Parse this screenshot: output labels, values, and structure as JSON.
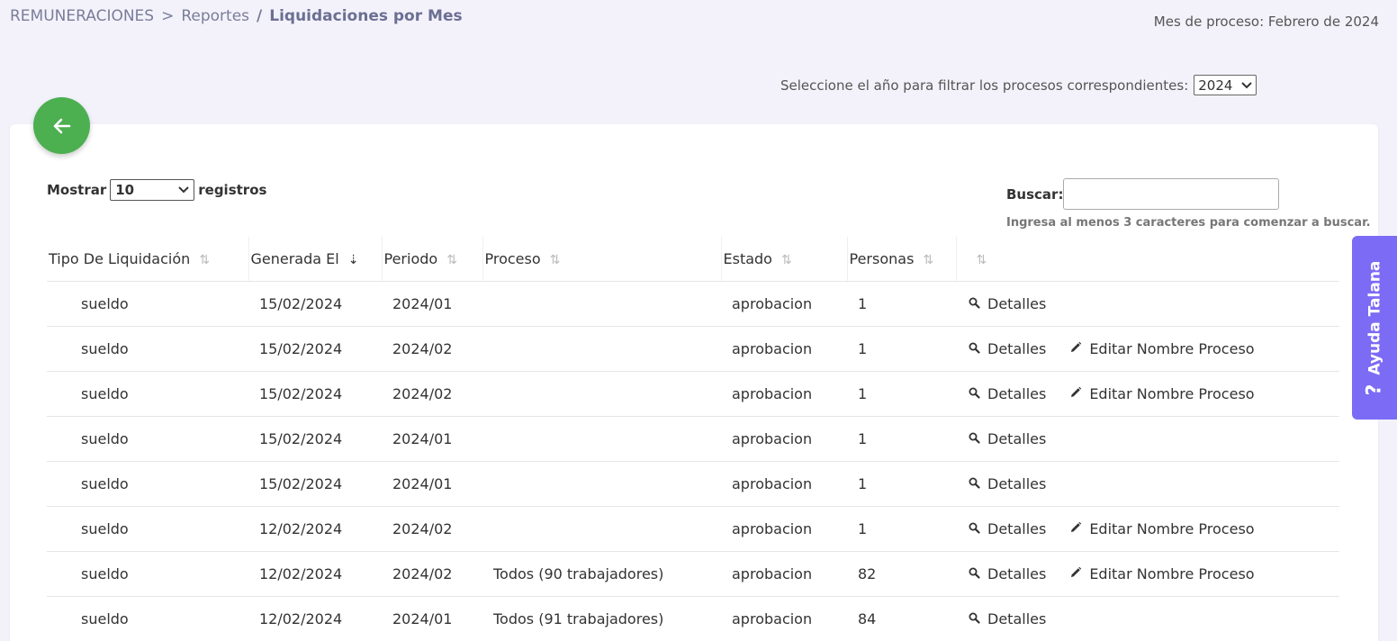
{
  "breadcrumb": {
    "root": "REMUNERACIONES",
    "sep1": ">",
    "level2": "Reportes",
    "sep2": "/",
    "current": "Liquidaciones por Mes"
  },
  "process_month": "Mes de proceso: Febrero de 2024",
  "year_filter": {
    "label": "Seleccione el año para filtrar los procesos correspondientes:",
    "value": "2024"
  },
  "length": {
    "prefix": "Mostrar",
    "value": "10",
    "suffix": "registros"
  },
  "search": {
    "label": "Buscar:",
    "value": "",
    "hint": "Ingresa al menos 3 caracteres para comenzar a buscar."
  },
  "table": {
    "headers": [
      "Tipo De Liquidación",
      "Generada El",
      "Periodo",
      "Proceso",
      "Estado",
      "Personas",
      ""
    ],
    "rows": [
      {
        "tipo": "sueldo",
        "generada": "15/02/2024",
        "periodo": "2024/01",
        "proceso": "",
        "estado": "aprobacion",
        "personas": "1",
        "detalles": "Detalles",
        "editar": ""
      },
      {
        "tipo": "sueldo",
        "generada": "15/02/2024",
        "periodo": "2024/02",
        "proceso": "",
        "estado": "aprobacion",
        "personas": "1",
        "detalles": "Detalles",
        "editar": "Editar Nombre Proceso"
      },
      {
        "tipo": "sueldo",
        "generada": "15/02/2024",
        "periodo": "2024/02",
        "proceso": "",
        "estado": "aprobacion",
        "personas": "1",
        "detalles": "Detalles",
        "editar": "Editar Nombre Proceso"
      },
      {
        "tipo": "sueldo",
        "generada": "15/02/2024",
        "periodo": "2024/01",
        "proceso": "",
        "estado": "aprobacion",
        "personas": "1",
        "detalles": "Detalles",
        "editar": ""
      },
      {
        "tipo": "sueldo",
        "generada": "15/02/2024",
        "periodo": "2024/01",
        "proceso": "",
        "estado": "aprobacion",
        "personas": "1",
        "detalles": "Detalles",
        "editar": ""
      },
      {
        "tipo": "sueldo",
        "generada": "12/02/2024",
        "periodo": "2024/02",
        "proceso": "",
        "estado": "aprobacion",
        "personas": "1",
        "detalles": "Detalles",
        "editar": "Editar Nombre Proceso"
      },
      {
        "tipo": "sueldo",
        "generada": "12/02/2024",
        "periodo": "2024/02",
        "proceso": "Todos (90 trabajadores)",
        "estado": "aprobacion",
        "personas": "82",
        "detalles": "Detalles",
        "editar": "Editar Nombre Proceso"
      },
      {
        "tipo": "sueldo",
        "generada": "12/02/2024",
        "periodo": "2024/01",
        "proceso": "Todos (91 trabajadores)",
        "estado": "aprobacion",
        "personas": "84",
        "detalles": "Detalles",
        "editar": ""
      }
    ]
  },
  "help_tab": {
    "label": "Ayuda Talana",
    "icon": "question-mark-icon"
  },
  "icons": {
    "back": "arrow-left-icon",
    "sort": "sort-icon",
    "details": "search-icon",
    "edit": "pencil-icon"
  },
  "colors": {
    "accent_green": "#4caf50",
    "help_purple": "#7c6bf5",
    "background": "#f3f2fb"
  }
}
